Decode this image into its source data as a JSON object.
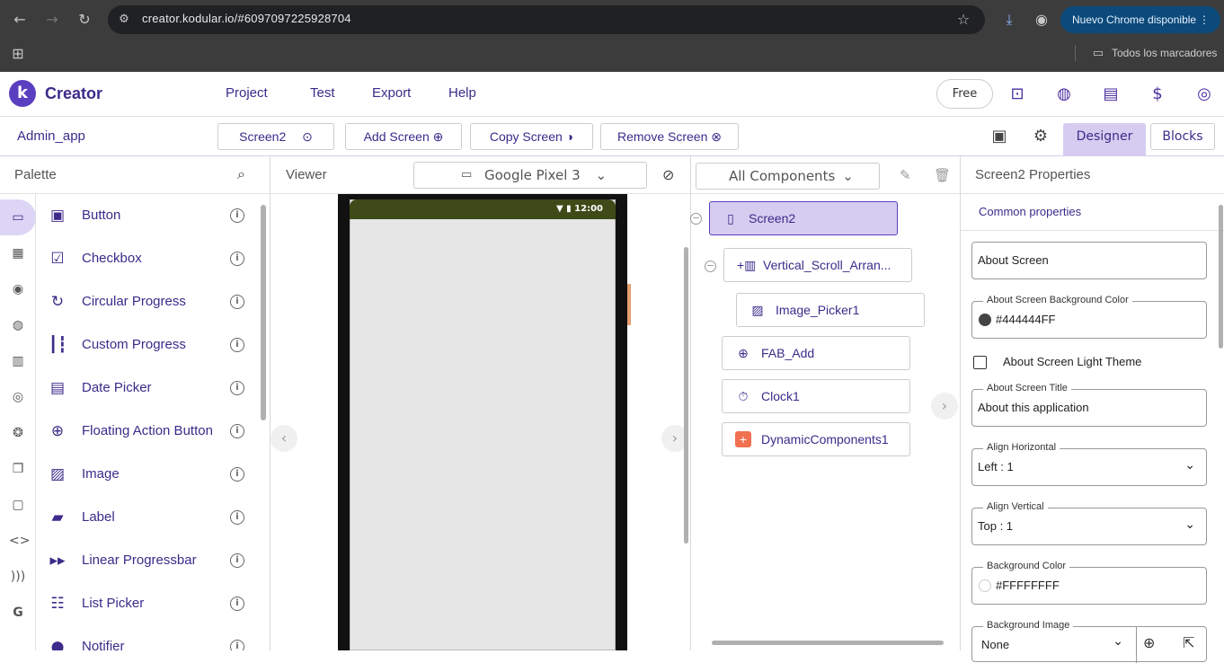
{
  "browser": {
    "url": "creator.kodular.io/#6097097225928704",
    "update_label": "Nuevo Chrome disponible",
    "bookmarks_label": "Todos los marcadores"
  },
  "app": {
    "logo_letter": "k",
    "name": "Creator",
    "menu": [
      "Project",
      "Test",
      "Export",
      "Help"
    ],
    "plan_label": "Free"
  },
  "toolbar": {
    "project_name": "Admin_app",
    "screen_select": "Screen2",
    "add_screen": "Add Screen",
    "copy_screen": "Copy Screen",
    "remove_screen": "Remove Screen",
    "designer": "Designer",
    "blocks": "Blocks"
  },
  "palette": {
    "title": "Palette",
    "items": [
      {
        "label": "Button",
        "icon": "button-icon"
      },
      {
        "label": "Checkbox",
        "icon": "checkbox-icon"
      },
      {
        "label": "Circular Progress",
        "icon": "circular-progress-icon"
      },
      {
        "label": "Custom Progress",
        "icon": "custom-progress-icon"
      },
      {
        "label": "Date Picker",
        "icon": "date-picker-icon"
      },
      {
        "label": "Floating Action Button",
        "icon": "fab-icon"
      },
      {
        "label": "Image",
        "icon": "image-icon"
      },
      {
        "label": "Label",
        "icon": "label-icon"
      },
      {
        "label": "Linear Progressbar",
        "icon": "linear-progress-icon"
      },
      {
        "label": "List Picker",
        "icon": "list-picker-icon"
      },
      {
        "label": "Notifier",
        "icon": "notifier-icon"
      }
    ]
  },
  "viewer": {
    "title": "Viewer",
    "device": "Google Pixel 3",
    "status_time": "12:00"
  },
  "components": {
    "filter": "All Components",
    "tree": [
      {
        "label": "Screen2",
        "icon": "phone-icon",
        "selected": true
      },
      {
        "label": "Vertical_Scroll_Arran...",
        "icon": "vertical-scroll-icon"
      },
      {
        "label": "Image_Picker1",
        "icon": "image-picker-icon"
      },
      {
        "label": "FAB_Add",
        "icon": "fab-add-icon"
      },
      {
        "label": "Clock1",
        "icon": "clock-icon"
      },
      {
        "label": "DynamicComponents1",
        "icon": "dynamic-components-icon"
      }
    ]
  },
  "properties": {
    "title": "Screen2 Properties",
    "section": "Common properties",
    "about_screen": "About Screen",
    "bg_color_label": "About Screen Background Color",
    "bg_color_value": "#444444FF",
    "light_theme_label": "About Screen Light Theme",
    "title_label": "About Screen Title",
    "title_value": "About this application",
    "align_h_label": "Align Horizontal",
    "align_h_value": "Left : 1",
    "align_v_label": "Align Vertical",
    "align_v_value": "Top : 1",
    "background_color_label": "Background Color",
    "background_color_value": "#FFFFFFFF",
    "background_image_label": "Background Image",
    "background_image_value": "None"
  },
  "colors": {
    "brand": "#3d2a8a",
    "accent": "#d5ccf0",
    "status_bar": "#3e4a18"
  }
}
